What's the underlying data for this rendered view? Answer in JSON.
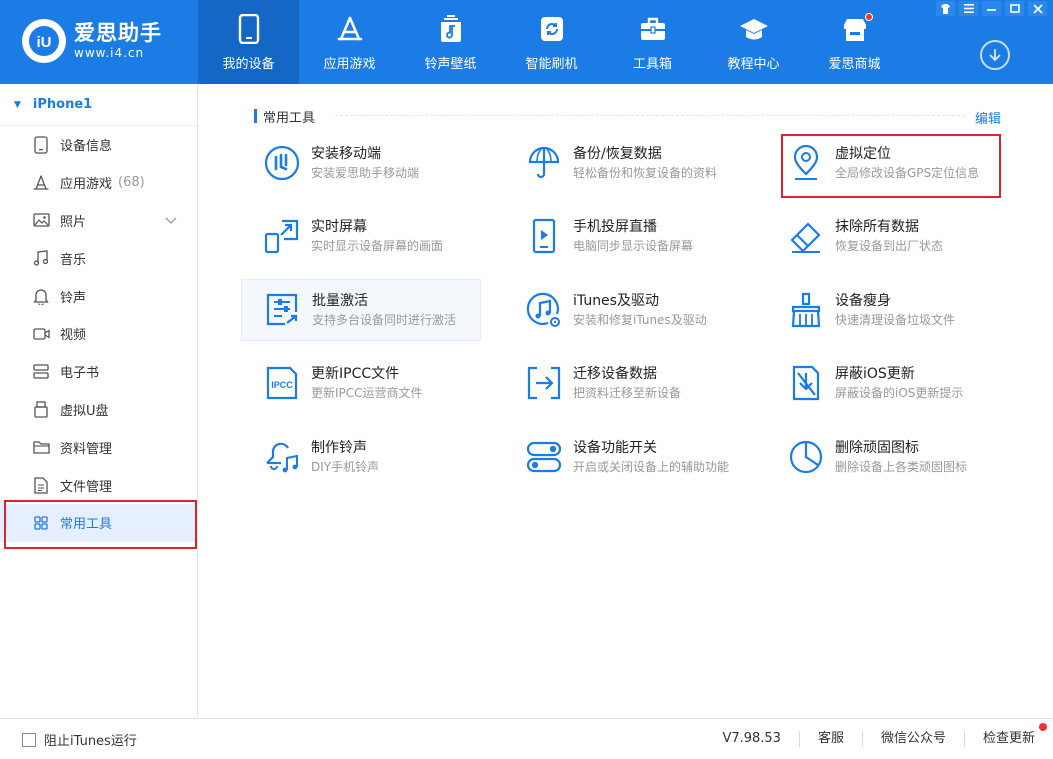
{
  "app": {
    "logo_name": "爱思助手",
    "logo_url": "www.i4.cn",
    "brand_color": "#1b7ce5",
    "accent_color": "#d9262e"
  },
  "nav": {
    "items": [
      {
        "label": "我的设备",
        "icon": "phone-icon",
        "active": true
      },
      {
        "label": "应用游戏",
        "icon": "app-store-icon"
      },
      {
        "label": "铃声壁纸",
        "icon": "music-icon"
      },
      {
        "label": "智能刷机",
        "icon": "refresh-icon"
      },
      {
        "label": "工具箱",
        "icon": "toolbox-icon"
      },
      {
        "label": "教程中心",
        "icon": "graduation-cap-icon"
      },
      {
        "label": "爱思商城",
        "icon": "shop-icon",
        "badge": true
      }
    ]
  },
  "window": {
    "controls": [
      "shirt-icon",
      "menu-icon",
      "minimize-icon",
      "maximize-icon",
      "close-icon"
    ]
  },
  "sidebar": {
    "device_name": "iPhone1",
    "items": [
      {
        "label": "设备信息",
        "icon": "device-info-icon"
      },
      {
        "label": "应用游戏",
        "icon": "app-store-icon",
        "count": "(68)"
      },
      {
        "label": "照片",
        "icon": "photo-icon",
        "expandable": true
      },
      {
        "label": "音乐",
        "icon": "music-note-icon"
      },
      {
        "label": "铃声",
        "icon": "bell-icon"
      },
      {
        "label": "视频",
        "icon": "video-icon"
      },
      {
        "label": "电子书",
        "icon": "ebook-icon"
      },
      {
        "label": "虚拟U盘",
        "icon": "usb-drive-icon"
      },
      {
        "label": "资料管理",
        "icon": "folder-icon"
      },
      {
        "label": "文件管理",
        "icon": "file-icon"
      },
      {
        "label": "常用工具",
        "icon": "grid-icon",
        "active": true
      }
    ]
  },
  "main": {
    "section_title": "常用工具",
    "edit_label": "编辑",
    "tools": [
      {
        "name": "安装移动端",
        "desc": "安装爱思助手移动端",
        "icon": "i4-logo-icon"
      },
      {
        "name": "备份/恢复数据",
        "desc": "轻松备份和恢复设备的资料",
        "icon": "umbrella-icon"
      },
      {
        "name": "虚拟定位",
        "desc": "全局修改设备GPS定位信息",
        "icon": "location-pin-icon"
      },
      {
        "name": "实时屏幕",
        "desc": "实时显示设备屏幕的画面",
        "icon": "screen-mirror-icon"
      },
      {
        "name": "手机投屏直播",
        "desc": "电脑同步显示设备屏幕",
        "icon": "phone-play-icon"
      },
      {
        "name": "抹除所有数据",
        "desc": "恢复设备到出厂状态",
        "icon": "eraser-icon"
      },
      {
        "name": "批量激活",
        "desc": "支持多台设备同时进行激活",
        "icon": "batch-activate-icon"
      },
      {
        "name": "iTunes及驱动",
        "desc": "安装和修复iTunes及驱动",
        "icon": "itunes-icon"
      },
      {
        "name": "设备瘦身",
        "desc": "快速清理设备垃圾文件",
        "icon": "broom-icon"
      },
      {
        "name": "更新IPCC文件",
        "desc": "更新IPCC运营商文件",
        "icon": "ipcc-icon"
      },
      {
        "name": "迁移设备数据",
        "desc": "把资料迁移至新设备",
        "icon": "migrate-icon"
      },
      {
        "name": "屏蔽iOS更新",
        "desc": "屏蔽设备的iOS更新提示",
        "icon": "block-update-icon"
      },
      {
        "name": "制作铃声",
        "desc": "DIY手机铃声",
        "icon": "bell-music-icon"
      },
      {
        "name": "设备功能开关",
        "desc": "开启或关闭设备上的辅助功能",
        "icon": "toggle-icon"
      },
      {
        "name": "删除顽固图标",
        "desc": "删除设备上各类顽固图标",
        "icon": "pie-chart-icon"
      }
    ]
  },
  "footer": {
    "block_itunes_label": "阻止iTunes运行",
    "version": "V7.98.53",
    "support": "客服",
    "wechat": "微信公众号",
    "check_update": "检查更新"
  }
}
